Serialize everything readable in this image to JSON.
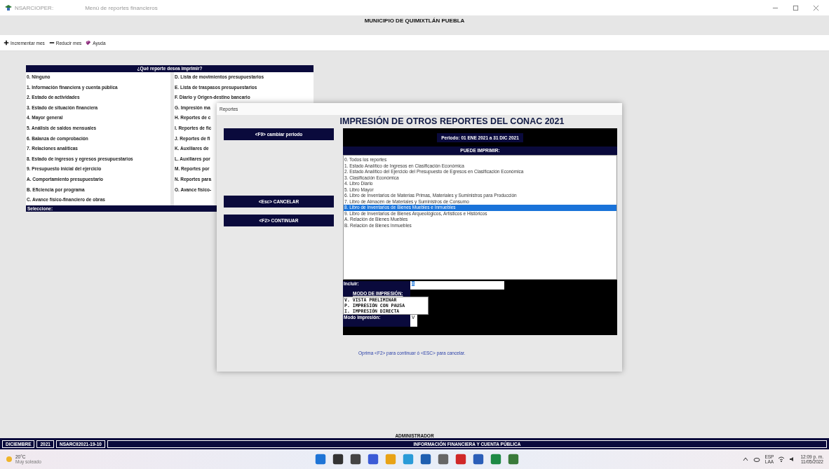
{
  "app": {
    "name": "NSARCIOPER:",
    "window_title": "Menú de reportes financieros",
    "org": "MUNICIPIO DE QUIMIXTLÁN PUEBLA"
  },
  "toolbar": [
    {
      "kind": "plus",
      "label": "Incrementar mes"
    },
    {
      "kind": "minus",
      "label": "Reducir mes"
    },
    {
      "kind": "book",
      "label": "Ayuda"
    }
  ],
  "menu": {
    "title": "¿Qué reporte desea imprimir?",
    "column_1": [
      "0. Ninguno",
      "1. Información financiera y cuenta pública",
      "2. Estado de actividades",
      "3. Estado de situación financiera",
      "4. Mayor general",
      "5. Análisis de saldos mensuales",
      "6. Balanza de comprobación",
      "7. Relaciones analíticas",
      "8. Estado de ingresos y egresos presupuestarios",
      "9. Presupuesto inicial del ejercicio",
      "A. Comportamiento presupuestario",
      "B. Eficiencia por programa",
      "C. Avance físico-financiero de obras"
    ],
    "column_2": [
      "D. Lista de movimientos presupuestarios",
      "E. Lista de traspasos presupuestarios",
      "F. Diario y Origen-destino bancario",
      "G. Impresión ma",
      "H. Reportes de c",
      "I. Reportes de fic",
      "J. Reportes de fi",
      "K. Auxiliares de",
      "L. Auxiliares por",
      "M. Reportes por",
      "N. Reportes para",
      "O. Avance físico-"
    ],
    "prompt": "Seleccione:"
  },
  "dialog": {
    "title": "Reportes",
    "heading": "IMPRESIÓN DE OTROS REPORTES DEL CONAC 2021",
    "buttons": [
      "<F9> cambiar periodo",
      "<Esc> CANCELAR",
      "<F2> CONTINUAR"
    ],
    "period": "Periodo: 01 ENE 2021 a 31 DIC 2021",
    "list_title": "PUEDE IMPRIMIR:",
    "reports": [
      {
        "label": "0. Todos los reportes",
        "selected": false
      },
      {
        "label": "1. Estado Analítico de Ingresos en Clasificación Económica",
        "selected": false
      },
      {
        "label": "2. Estado Analítico del Ejercicio del Presupuesto de Egresos en Clasificación Económica",
        "selected": false
      },
      {
        "label": "3. Clasificación Económica",
        "selected": false
      },
      {
        "label": "4. Libro Diario",
        "selected": false
      },
      {
        "label": "5. Libro Mayor",
        "selected": false
      },
      {
        "label": "6. Libro de Inventarios de Materias Primas, Materiales y Suministros para Producción",
        "selected": false
      },
      {
        "label": "7. Libro de Almacén de Materiales y Suministros de Consumo",
        "selected": false
      },
      {
        "label": "8. Libro de Inventarios de Bienes Muebles e Inmuebles",
        "selected": true
      },
      {
        "label": "9. Libro de Inventarios de Bienes Arqueológicos, Artísticos e Históricos",
        "selected": false
      },
      {
        "label": "A. Relación de Bienes Muebles",
        "selected": false
      },
      {
        "label": "B. Relación de Bienes Inmuebles",
        "selected": false
      }
    ],
    "include_label": "Incluir:",
    "include_value": "8",
    "mode_title": "MODO DE IMPRESIÓN:",
    "modes": [
      "V. VISTA PRELIMINAR",
      "P. IMPRESIÓN CON PAUSA",
      "I. IMPRESIÓN DIRECTA"
    ],
    "mode_label": "Modo impresión:",
    "mode_value": "V",
    "hint": "Oprima <F2> para continuar ó <ESC> para cancelar."
  },
  "footer": {
    "user": "ADMINISTRADOR",
    "cells": [
      "DICIEMBRE",
      "2021",
      "NSARCII2021-19-10"
    ],
    "section": "INFORMACIÓN FINANCIERA Y CUENTA PÚBLICA"
  },
  "taskbar": {
    "temperature": "20°C",
    "weather": "Muy soleado",
    "lang": "ESP",
    "layout": "LAA",
    "time": "12:09 p. m.",
    "date": "11/05/2022"
  }
}
